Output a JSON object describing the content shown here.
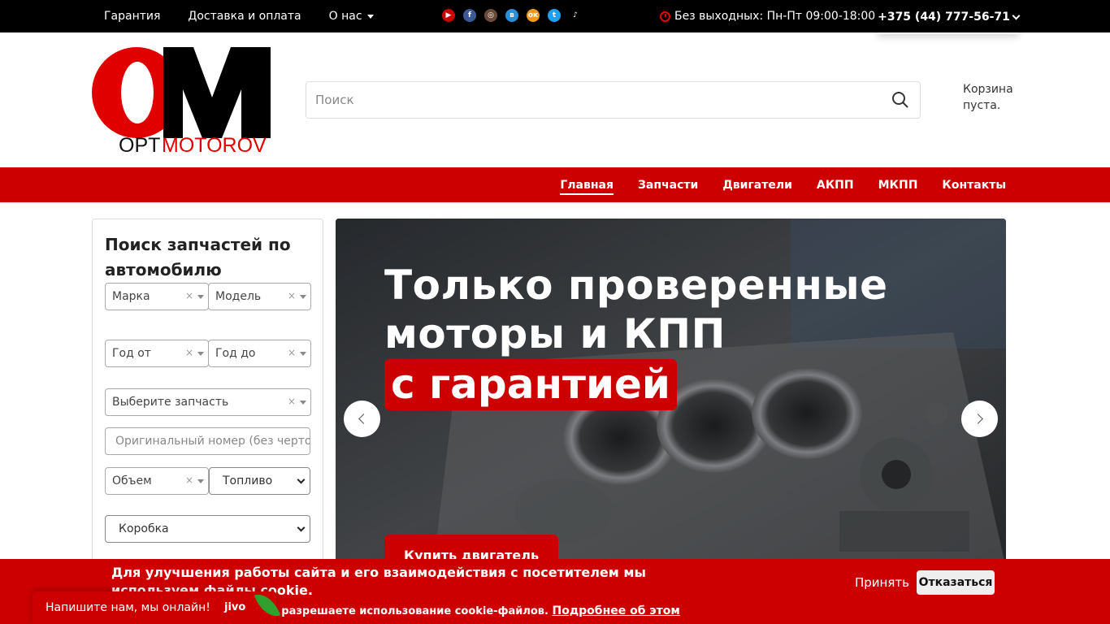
{
  "topbar": {
    "links": [
      "Гарантия",
      "Доставка и оплата",
      "О нас"
    ],
    "hours": "Без выходных: Пн-Пт 09:00-18:00",
    "phone": "+375 (44) 777-56-71",
    "socials": [
      {
        "name": "youtube-icon",
        "color": "#cc0000",
        "glyph": "▶"
      },
      {
        "name": "facebook-icon",
        "color": "#3b5998",
        "glyph": "f"
      },
      {
        "name": "instagram-icon",
        "color": "#6b4a3a",
        "glyph": "◎"
      },
      {
        "name": "vk-icon",
        "color": "#2a8fd8",
        "glyph": "в"
      },
      {
        "name": "odnoklassniki-icon",
        "color": "#f39a1c",
        "glyph": "ок"
      },
      {
        "name": "twitter-icon",
        "color": "#1da1f2",
        "glyph": "t"
      },
      {
        "name": "tiktok-icon",
        "color": "#000000",
        "glyph": "♪"
      }
    ]
  },
  "logo": {
    "opt": "OPT",
    "motorov": "MOTOROV"
  },
  "search": {
    "placeholder": "Поиск"
  },
  "cart": {
    "text": "Корзина пуста."
  },
  "mainnav": {
    "items": [
      "Главная",
      "Запчасти",
      "Двигатели",
      "АКПП",
      "МКПП",
      "Контакты"
    ]
  },
  "sidebar": {
    "title": "Поиск запчастей по автомобилю",
    "brand": "Марка",
    "model": "Модель",
    "year_from": "Год от",
    "year_to": "Год до",
    "part": "Выберите запчасть",
    "oem_placeholder": "Оригинальный номер (без черточек)",
    "volume": "Объем",
    "fuel": "Топливо",
    "gearbox": "Коробка",
    "clear": "×"
  },
  "hero": {
    "line1": "Только проверенные",
    "line2": "моторы и КПП",
    "highlight": "с гарантией",
    "button": "Купить двигатель"
  },
  "cookie": {
    "message": "Для улучшения работы сайта и его взаимодействия с посетителем мы используем файлы cookie.",
    "sub": "ы разрешаете использование cookie-файлов.",
    "more": "Подробнее об этом",
    "accept": "Принять",
    "deny": "Отказаться"
  },
  "chat": {
    "text": "Напишите нам, мы онлайн!",
    "brand": "jivo"
  },
  "colors": {
    "brand_red": "#cc0000",
    "black": "#000000"
  }
}
